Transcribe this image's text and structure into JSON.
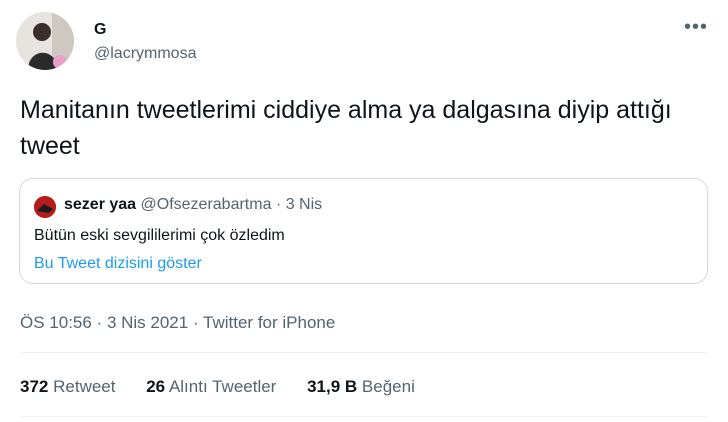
{
  "author": {
    "display_name": "G",
    "handle": "@lacrymmosa"
  },
  "more_icon": "more-dots-icon",
  "tweet": {
    "text": "Manitanın tweetlerimi ciddiye alma ya dalgasına diyip attığı tweet"
  },
  "quote": {
    "name": "sezer yaa",
    "handle": "@Ofsezerabartma",
    "separator": " · ",
    "date": "3 Nis",
    "text": "Bütün eski sevgililerimi çok özledim",
    "thread_link": "Bu Tweet dizisini göster"
  },
  "meta": {
    "time": "ÖS 10:56",
    "sep1": " · ",
    "date": "3 Nis 2021",
    "sep2": " · ",
    "source": "Twitter for iPhone"
  },
  "stats": {
    "retweets_count": "372",
    "retweets_label": "Retweet",
    "quotes_count": "26",
    "quotes_label": "Alıntı Tweetler",
    "likes_count": "31,9 B",
    "likes_label": "Beğeni"
  },
  "colors": {
    "text": "#0f1419",
    "secondary": "#536471",
    "link": "#1d9bf0",
    "border": "#cfd9de"
  }
}
